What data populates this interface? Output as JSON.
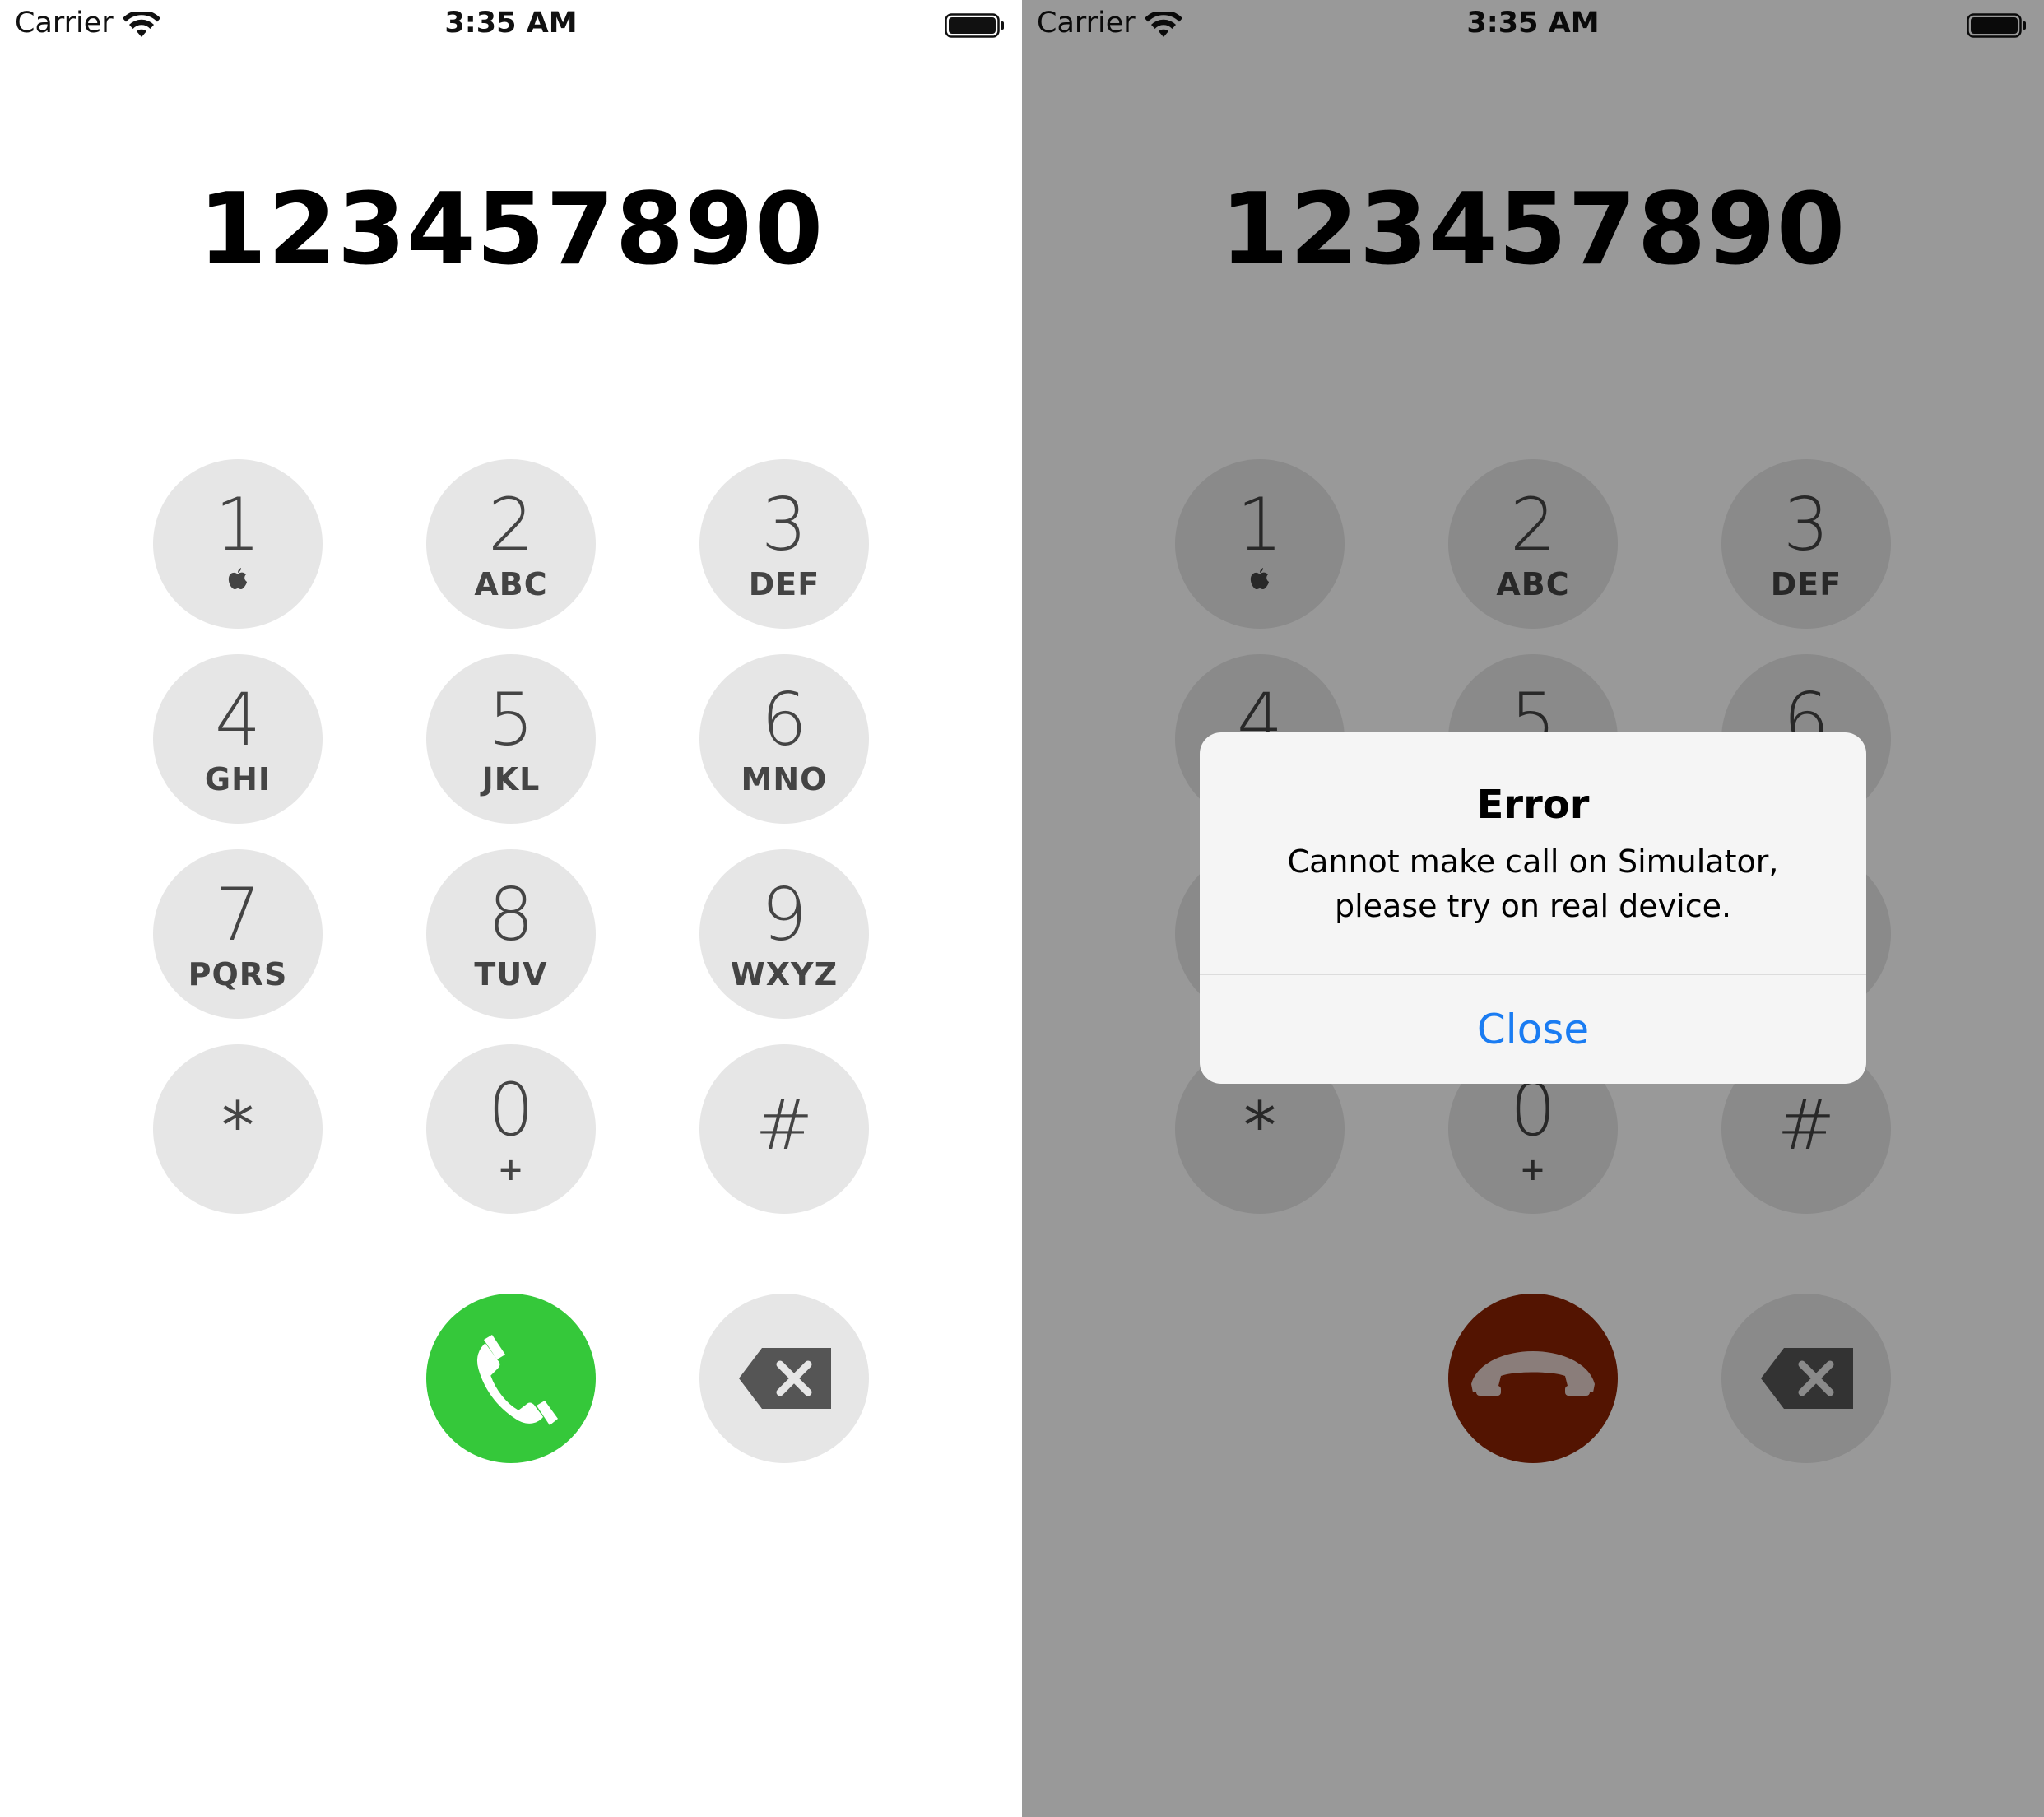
{
  "status_bar": {
    "carrier": "Carrier",
    "time": "3:35 AM"
  },
  "dialed_number": "123457890",
  "keypad": [
    {
      "digit": "1",
      "sub": ""
    },
    {
      "digit": "2",
      "sub": "ABC"
    },
    {
      "digit": "3",
      "sub": "DEF"
    },
    {
      "digit": "4",
      "sub": "GHI"
    },
    {
      "digit": "5",
      "sub": "JKL"
    },
    {
      "digit": "6",
      "sub": "MNO"
    },
    {
      "digit": "7",
      "sub": "PQRS"
    },
    {
      "digit": "8",
      "sub": "TUV"
    },
    {
      "digit": "9",
      "sub": "WXYZ"
    },
    {
      "digit": "*",
      "sub": ""
    },
    {
      "digit": "0",
      "sub": "+"
    },
    {
      "digit": "#",
      "sub": ""
    }
  ],
  "alert": {
    "title": "Error",
    "message": "Cannot make call on Simulator, please try on real device.",
    "button": "Close"
  },
  "colors": {
    "call_green": "#35c83a",
    "hangup_red": "#8a2203",
    "key_bg": "#e6e6e6",
    "alert_button": "#1a7cf2"
  },
  "icons": [
    "wifi-icon",
    "battery-icon",
    "apple-logo-icon",
    "phone-icon",
    "hangup-icon",
    "backspace-icon"
  ]
}
